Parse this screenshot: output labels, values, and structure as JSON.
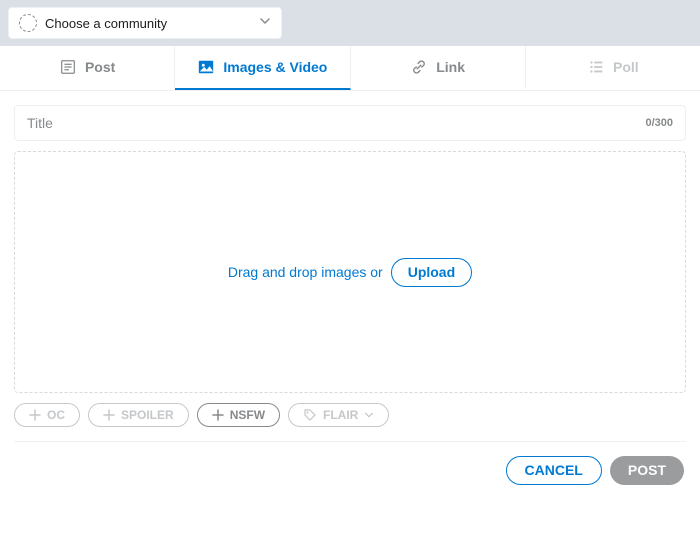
{
  "community": {
    "placeholder": "Choose a community"
  },
  "tabs": {
    "post": "Post",
    "images": "Images & Video",
    "link": "Link",
    "poll": "Poll"
  },
  "title": {
    "placeholder": "Title",
    "counter": "0/300"
  },
  "dropzone": {
    "text": "Drag and drop images or",
    "upload": "Upload"
  },
  "pills": {
    "oc": "OC",
    "spoiler": "SPOILER",
    "nsfw": "NSFW",
    "flair": "FLAIR"
  },
  "actions": {
    "cancel": "CANCEL",
    "post": "POST"
  }
}
